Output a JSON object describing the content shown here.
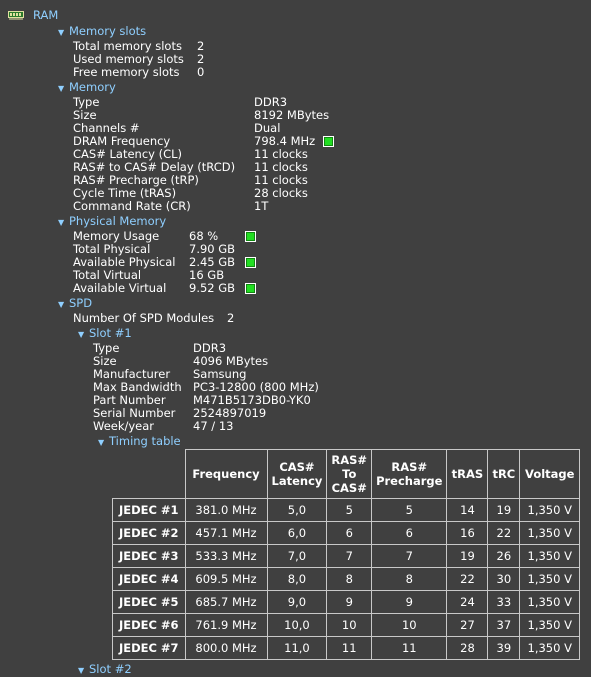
{
  "root": {
    "label": "RAM",
    "icon": "ram-module-icon"
  },
  "slots": {
    "title": "Memory slots",
    "rows": [
      {
        "label": "Total memory slots",
        "value": "2"
      },
      {
        "label": "Used memory slots",
        "value": "2"
      },
      {
        "label": "Free memory slots",
        "value": "0"
      }
    ]
  },
  "memory": {
    "title": "Memory",
    "rows": [
      {
        "label": "Type",
        "value": "DDR3"
      },
      {
        "label": "Size",
        "value": "8192 MBytes"
      },
      {
        "label": "Channels #",
        "value": "Dual"
      },
      {
        "label": "DRAM Frequency",
        "value": "798.4 MHz"
      },
      {
        "label": "CAS# Latency (CL)",
        "value": "11 clocks"
      },
      {
        "label": "RAS# to CAS# Delay (tRCD)",
        "value": "11 clocks"
      },
      {
        "label": "RAS# Precharge (tRP)",
        "value": "11 clocks"
      },
      {
        "label": "Cycle Time (tRAS)",
        "value": "28 clocks"
      },
      {
        "label": "Command Rate (CR)",
        "value": "1T"
      }
    ]
  },
  "physical": {
    "title": "Physical Memory",
    "rows": [
      {
        "label": "Memory Usage",
        "value": "68 %"
      },
      {
        "label": "Total Physical",
        "value": "7.90 GB"
      },
      {
        "label": "Available Physical",
        "value": "2.45 GB"
      },
      {
        "label": "Total Virtual",
        "value": "16 GB"
      },
      {
        "label": "Available Virtual",
        "value": "9.52 GB"
      }
    ]
  },
  "spd": {
    "title": "SPD",
    "modules_label": "Number Of SPD Modules",
    "modules_value": "2",
    "slot1": {
      "title": "Slot #1",
      "rows": [
        {
          "label": "Type",
          "value": "DDR3"
        },
        {
          "label": "Size",
          "value": "4096 MBytes"
        },
        {
          "label": "Manufacturer",
          "value": "Samsung"
        },
        {
          "label": "Max Bandwidth",
          "value": "PC3-12800 (800 MHz)"
        },
        {
          "label": "Part Number",
          "value": "M471B5173DB0-YK0"
        },
        {
          "label": "Serial Number",
          "value": "2524897019"
        },
        {
          "label": "Week/year",
          "value": "47 / 13"
        }
      ],
      "timing_title": "Timing table",
      "timing": {
        "headers": [
          "Frequency",
          "CAS# Latency",
          "RAS# To CAS#",
          "RAS# Precharge",
          "tRAS",
          "tRC",
          "Voltage"
        ],
        "rows": [
          {
            "name": "JEDEC #1",
            "cells": [
              "381.0 MHz",
              "5,0",
              "5",
              "5",
              "14",
              "19",
              "1,350 V"
            ]
          },
          {
            "name": "JEDEC #2",
            "cells": [
              "457.1 MHz",
              "6,0",
              "6",
              "6",
              "16",
              "22",
              "1,350 V"
            ]
          },
          {
            "name": "JEDEC #3",
            "cells": [
              "533.3 MHz",
              "7,0",
              "7",
              "7",
              "19",
              "26",
              "1,350 V"
            ]
          },
          {
            "name": "JEDEC #4",
            "cells": [
              "609.5 MHz",
              "8,0",
              "8",
              "8",
              "22",
              "30",
              "1,350 V"
            ]
          },
          {
            "name": "JEDEC #5",
            "cells": [
              "685.7 MHz",
              "9,0",
              "9",
              "9",
              "24",
              "33",
              "1,350 V"
            ]
          },
          {
            "name": "JEDEC #6",
            "cells": [
              "761.9 MHz",
              "10,0",
              "10",
              "10",
              "27",
              "37",
              "1,350 V"
            ]
          },
          {
            "name": "JEDEC #7",
            "cells": [
              "800.0 MHz",
              "11,0",
              "11",
              "11",
              "28",
              "39",
              "1,350 V"
            ]
          }
        ]
      }
    },
    "slot2_title": "Slot #2"
  },
  "colors": {
    "background": "#404040",
    "section": "#8fcfff",
    "indicator": "#22dd22"
  }
}
